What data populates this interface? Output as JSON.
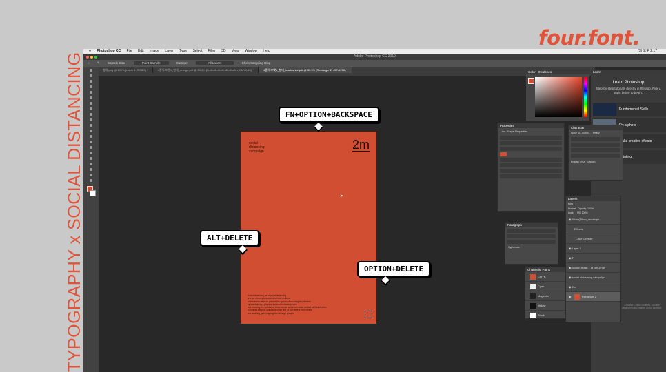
{
  "brand": "four.font.",
  "vertical_caption": "TYPOGRAPHY x SOCIAL DISTANCING",
  "menubar": {
    "apple": "",
    "items": [
      "Photoshop CC",
      "File",
      "Edit",
      "Image",
      "Layer",
      "Type",
      "Select",
      "Filter",
      "3D",
      "View",
      "Window",
      "Help"
    ],
    "clock": "(3) 오후 2:17"
  },
  "window_title": "Adobe Photoshop CC 2019",
  "options_bar": {
    "sample_size_label": "Sample Size:",
    "sample_size_value": "Point Sample",
    "sample_label": "Sample:",
    "sample_value": "All Layers",
    "show_ring": "Show Sampling Ring"
  },
  "tabs": [
    {
      "label": "형태.png @ 100% (Layer 1, RGB/8) *",
      "active": false
    },
    {
      "label": "4종이/포맷1_형태_orange.pdf @ 33.3% (2m2m2m2m2m2m2m2m, CMYK/16) *",
      "active": false
    },
    {
      "label": "4종이/포맷1_형태_blackwhite.pdf @ 33.3% (Rectangle 2, CMYK/16) *",
      "active": true
    }
  ],
  "poster": {
    "heading": [
      "social",
      "distancing",
      "campaign"
    ],
    "big": "2m",
    "body": [
      "Social distancing, or physical distancing",
      "is a set of non-pharmaceutical interventions",
      "or measures taken to prevent the spread of a contagious disease",
      "by maintaining a physical distance between people",
      "and reducing the number of times people come into close contact with each other.",
      "It involves keeping a distance of six feet or two meters from others",
      "and avoiding gathering together in large groups."
    ]
  },
  "bubbles": {
    "top": "FN+OPTION+BACKSPACE",
    "left": "ALT+DELETE",
    "right": "OPTION+DELETE"
  },
  "panels": {
    "color_tab": "Color",
    "swatches_tab": "Swatches",
    "learn_tab": "Learn",
    "learn_title": "Learn Photoshop",
    "learn_desc": "Step-by-step tutorials directly in the app. Pick a topic below to begin.",
    "learn_items": [
      "Fundamental Skills",
      "Fix a photo",
      "Make creative effects",
      "Painting"
    ],
    "properties": "Properties",
    "properties_sub": "Live Shape Properties",
    "character": "Character",
    "character_font": "Apple SD Gothic...",
    "character_style": "Heavy",
    "character_lang": "English: USA",
    "character_aa": "Smooth",
    "paragraph": "Paragraph",
    "paragraph_hyphen": "Hyphenate",
    "layers": "Layers",
    "layers_kind": "Kind",
    "layers_blend": "Normal",
    "layers_opacity_label": "Opacity:",
    "layers_opacity": "100%",
    "layers_fill_label": "Fill:",
    "layers_fill": "100%",
    "layers_lock": "Lock:",
    "layer_items": [
      {
        "name": "50cm(50cm_rectangle",
        "sel": false
      },
      {
        "name": "Effects",
        "sel": false
      },
      {
        "name": "Color Overlay",
        "sel": false
      },
      {
        "name": "Layer 1",
        "sel": false
      },
      {
        "name": "T",
        "sel": false
      },
      {
        "name": "Social distan... of non-phar",
        "sel": false
      },
      {
        "name": "social distancing campaign",
        "sel": false
      },
      {
        "name": "2m",
        "sel": false
      },
      {
        "name": "Rectangle 2",
        "sel": true
      }
    ],
    "channels_tab": "Channels",
    "paths_tab": "Paths",
    "channels": [
      "CMYK",
      "Cyan",
      "Magenta",
      "Yellow",
      "Black"
    ],
    "cloud_note": "Creative Cloud Libraries, you are logged into a Creative Cloud account."
  },
  "colors": {
    "accent": "#e0553a",
    "poster": "#d24e32"
  }
}
